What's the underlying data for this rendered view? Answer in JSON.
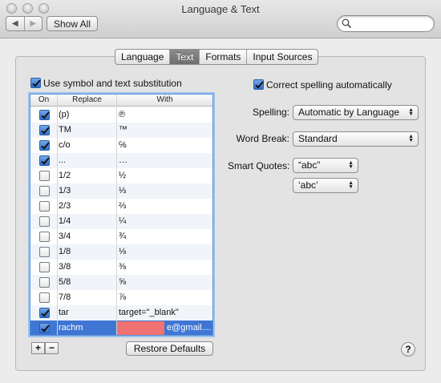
{
  "window": {
    "title": "Language & Text"
  },
  "toolbar": {
    "back_icon": "◀",
    "forward_icon": "▶",
    "show_all_label": "Show All",
    "search_value": ""
  },
  "tabs": [
    {
      "label": "Language",
      "active": false
    },
    {
      "label": "Text",
      "active": true
    },
    {
      "label": "Formats",
      "active": false
    },
    {
      "label": "Input Sources",
      "active": false
    }
  ],
  "left": {
    "use_substitution_label": "Use symbol and text substitution",
    "use_substitution_checked": true,
    "columns": {
      "on": "On",
      "replace": "Replace",
      "with": "With"
    },
    "rows": [
      {
        "on": true,
        "replace": "(p)",
        "with": "℗"
      },
      {
        "on": true,
        "replace": "TM",
        "with": "™"
      },
      {
        "on": true,
        "replace": "c/o",
        "with": "℅"
      },
      {
        "on": true,
        "replace": "...",
        "with": "…"
      },
      {
        "on": false,
        "replace": "1/2",
        "with": "½"
      },
      {
        "on": false,
        "replace": "1/3",
        "with": "⅓"
      },
      {
        "on": false,
        "replace": "2/3",
        "with": "⅔"
      },
      {
        "on": false,
        "replace": "1/4",
        "with": "¼"
      },
      {
        "on": false,
        "replace": "3/4",
        "with": "¾"
      },
      {
        "on": false,
        "replace": "1/8",
        "with": "⅛"
      },
      {
        "on": false,
        "replace": "3/8",
        "with": "⅜"
      },
      {
        "on": false,
        "replace": "5/8",
        "with": "⅝"
      },
      {
        "on": false,
        "replace": "7/8",
        "with": "⅞"
      },
      {
        "on": true,
        "replace": "tar",
        "with": "target=\"_blank\""
      },
      {
        "on": true,
        "replace": "rachm",
        "with": "e@gmail....",
        "selected": true,
        "redacted": true
      }
    ],
    "add_label": "+",
    "remove_label": "−",
    "restore_label": "Restore Defaults"
  },
  "right": {
    "correct_spelling_label": "Correct spelling automatically",
    "correct_spelling_checked": true,
    "spelling_label": "Spelling:",
    "spelling_value": "Automatic by Language",
    "word_break_label": "Word Break:",
    "word_break_value": "Standard",
    "smart_quotes_label": "Smart Quotes:",
    "double_quotes_value": "“abc”",
    "single_quotes_value": "‘abc’"
  },
  "help_label": "?",
  "colors": {
    "selection": "#3f76d3",
    "redaction": "#f07272",
    "checkbox_on": "#2b6fd0"
  }
}
